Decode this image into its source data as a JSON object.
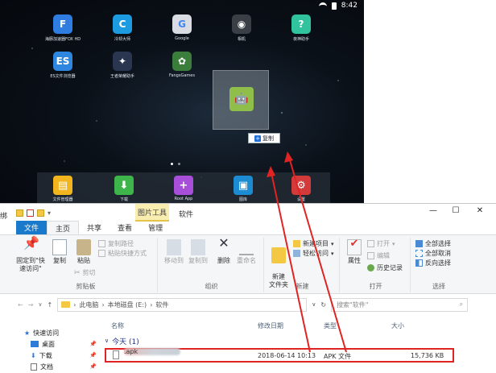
{
  "android": {
    "time": "8:42",
    "apps": [
      {
        "label": "海豚加速器FOX HD",
        "glyph": "F",
        "color": "#2f7de0"
      },
      {
        "label": "冷却大师",
        "glyph": "C",
        "color": "#1c9be0"
      },
      {
        "label": "Google",
        "glyph": "G",
        "color": "#d9dde3"
      },
      {
        "label": "相机",
        "glyph": "◉",
        "color": "#3a3f45"
      },
      {
        "label": "夜神助手",
        "glyph": "?",
        "color": "#30c39e"
      },
      {
        "label": "ES文件浏览器",
        "glyph": "ES",
        "color": "#2e86de"
      },
      {
        "label": "王者荣耀助手",
        "glyph": "✦",
        "color": "#2a3550"
      },
      {
        "label": "FangsGames",
        "glyph": "✿",
        "color": "#3b7d3b"
      }
    ],
    "copy_tooltip": "复制",
    "dock": [
      {
        "label": "文件管理器",
        "glyph": "▤",
        "color": "#f2b51d"
      },
      {
        "label": "下载",
        "glyph": "⬇",
        "color": "#3db54a"
      },
      {
        "label": "Root App",
        "glyph": "+",
        "color": "#a74fd9"
      },
      {
        "label": "图库",
        "glyph": "▣",
        "color": "#1d8bd1"
      },
      {
        "label": "设置",
        "glyph": "⚙",
        "color": "#d33b3b"
      }
    ]
  },
  "explorer": {
    "left_cut_text": "绑",
    "context_tab": "图片工具",
    "title": "软件",
    "tabs": [
      {
        "label": "文件",
        "kind": "file"
      },
      {
        "label": "主页",
        "kind": "active"
      },
      {
        "label": "共享",
        "kind": ""
      },
      {
        "label": "查看",
        "kind": ""
      },
      {
        "label": "管理",
        "kind": ""
      }
    ],
    "ribbon": {
      "pin_label": "固定到\"快速访问\"",
      "copy_label": "复制",
      "paste_label": "粘贴",
      "copy_path": "复制路径",
      "paste_shortcut": "粘贴快捷方式",
      "cut": "剪切",
      "clipboard_group": "剪贴板",
      "move_to": "移动到",
      "copy_to": "复制到",
      "delete": "删除",
      "rename": "重命名",
      "organize_group": "组织",
      "new_folder": "新建\n文件夹",
      "new_item": "新建项目",
      "easy_access": "轻松访问",
      "new_group": "新建",
      "properties": "属性",
      "open": "打开",
      "edit": "编辑",
      "history": "历史记录",
      "open_group": "打开",
      "select_all": "全部选择",
      "select_none": "全部取消",
      "invert": "反向选择",
      "select_group": "选择"
    },
    "address": {
      "crumbs": [
        "此电脑",
        "本地磁盘 (E:)",
        "软件"
      ],
      "search_placeholder": "搜索\"软件\""
    },
    "nav": [
      {
        "label": "快速访问",
        "pinned": false
      },
      {
        "label": "桌面",
        "pinned": true
      },
      {
        "label": "下载",
        "pinned": true
      },
      {
        "label": "文档",
        "pinned": true
      }
    ],
    "columns": [
      "名称",
      "修改日期",
      "类型",
      "大小"
    ],
    "group_label": "今天 (1)",
    "file": {
      "name_prefix": "w",
      "name_suffix": ".apk",
      "date": "2018-06-14 10:13",
      "type": "APK 文件",
      "size": "15,736 KB"
    }
  }
}
